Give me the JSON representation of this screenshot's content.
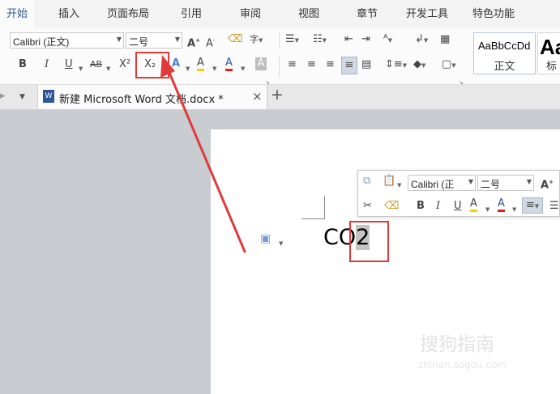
{
  "ribbon": {
    "tabs": [
      "开始",
      "插入",
      "页面布局",
      "引用",
      "审阅",
      "视图",
      "章节",
      "开发工具",
      "特色功能"
    ],
    "active_tab": 0
  },
  "toolbar": {
    "font_name": "Calibri (正文)",
    "font_size": "二号",
    "bold": "B",
    "italic": "I",
    "underline": "U",
    "strikethrough": "AB",
    "superscript": "X²",
    "subscript": "X₂",
    "font_color_letter": "A",
    "highlight_letter": "A"
  },
  "styles": [
    {
      "preview": "AaBbCcDd",
      "label": "正文"
    },
    {
      "preview": "Aa",
      "label": "标"
    }
  ],
  "document_tab": {
    "title": "新建 Microsoft Word 文档.docx *",
    "close": "×",
    "new_tab": "+"
  },
  "document": {
    "text": "CO",
    "selected_char": "2"
  },
  "mini_toolbar": {
    "font_name": "Calibri (正",
    "font_size": "二号"
  },
  "watermark": {
    "brand": "搜狗指南",
    "url": "zhinan.sogou.com"
  },
  "colors": {
    "accent": "#2b579a",
    "annotation_red": "#e03b3b",
    "font_color_bar": "#e02020"
  }
}
